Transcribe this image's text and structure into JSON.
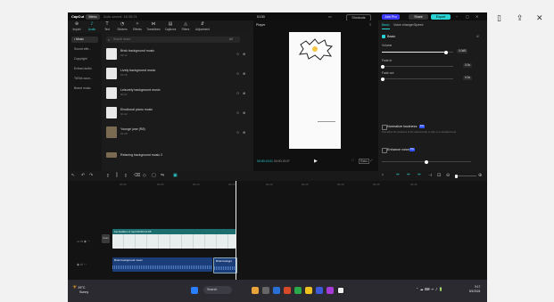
{
  "window": {
    "logo": "CapCut",
    "menu_label": "Menu",
    "autosave": "Auto saved: 18:35:21",
    "project_name": "0130",
    "shortcuts_label": "Shortcuts",
    "join_pro_label": "Join Pro",
    "share_label": "Share",
    "export_label": "Export"
  },
  "toolbar": {
    "items": [
      {
        "icon": "import-icon",
        "glyph": "⊕",
        "label": "Import"
      },
      {
        "icon": "audio-icon",
        "glyph": "♪",
        "label": "Audio"
      },
      {
        "icon": "text-icon",
        "glyph": "T",
        "label": "Text"
      },
      {
        "icon": "stickers-icon",
        "glyph": "◔",
        "label": "Stickers"
      },
      {
        "icon": "effects-icon",
        "glyph": "✧",
        "label": "Effects"
      },
      {
        "icon": "transitions-icon",
        "glyph": "⋈",
        "label": "Transitions"
      },
      {
        "icon": "captions-icon",
        "glyph": "▤",
        "label": "Captions"
      },
      {
        "icon": "filters-icon",
        "glyph": "◬",
        "label": "Filters"
      },
      {
        "icon": "adjustment-icon",
        "glyph": "⇵",
        "label": "Adjustment"
      }
    ]
  },
  "leftnav": {
    "items": [
      "• Music",
      "Sound effe...",
      "Copyright",
      "Extract audio",
      "TikTok soun...",
      "Brand music"
    ]
  },
  "library": {
    "search_placeholder": "Search music",
    "sort_label": "All",
    "tracks": [
      {
        "name": "Brisk background music",
        "duration": "02:12"
      },
      {
        "name": "Lively background music",
        "duration": "01:15"
      },
      {
        "name": "Leisurely background music",
        "duration": "02:07"
      },
      {
        "name": "Emotional piano music",
        "duration": "01:42"
      },
      {
        "name": "Younge jose (R8)",
        "duration": "02:28"
      },
      {
        "name": "Relaxing background music 2",
        "duration": ""
      }
    ]
  },
  "player": {
    "title": "Player",
    "current_time": "00:00:13:01",
    "total_time": "00:00:19:07",
    "ratio_label": "Ratio"
  },
  "props": {
    "tabs": [
      "Basic",
      "Voice changer",
      "Speed"
    ],
    "basic_label": "Basic",
    "volume_label": "Volume",
    "volume_value": "0.0dB",
    "volume_level": 0.9,
    "fade_in_label": "Fade in",
    "fade_in_value": "0.0s",
    "fade_out_label": "Fade out",
    "fade_out_value": "0.0s",
    "normalize_label": "Normalize loudness",
    "normalize_desc": "Normalize the loudness of the selected clip or clips to a standard level",
    "enhance_label": "Enhance voice",
    "pro_badge": "Pro"
  },
  "timeline": {
    "ruler": [
      "00:00",
      "00:05",
      "00:10",
      "00:15",
      "00:20",
      "00:25",
      "00:30",
      "00:35",
      "00:40"
    ],
    "video_clip_label": "1st Audition 2.mp4  00:00:12:05",
    "cover_label": "Cover",
    "audio_clip_1": "Brisk background music",
    "audio_clip_2": "Brisk backgro"
  },
  "taskbar": {
    "temp": "29°C",
    "weather": "Sunny",
    "search_label": "Search",
    "time": "9:17",
    "date": "8/1/2024"
  },
  "colors": {
    "accent": "#2ad3d3",
    "audio_clip": "#1b3e7a",
    "video_clip": "#1d6e6e"
  }
}
